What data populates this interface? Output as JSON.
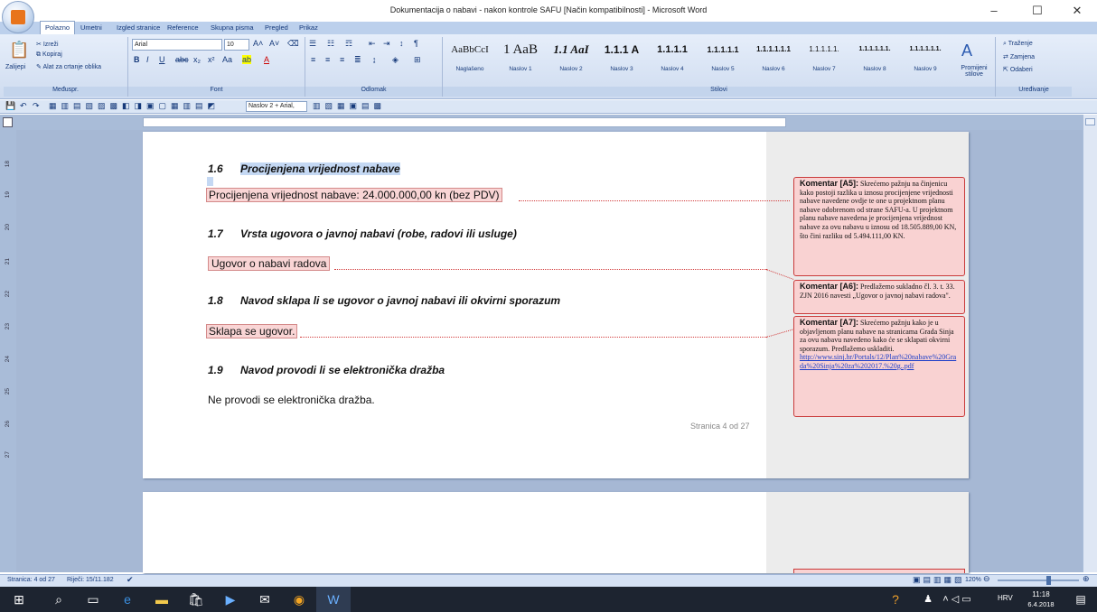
{
  "window": {
    "title": "Dokumentacija o nabavi - nakon kontrole SAFU [Način kompatibilnosti] - Microsoft Word",
    "minimize": "–",
    "maximize": "☐",
    "close": "✕"
  },
  "tabs": [
    "Polazno",
    "Umetni",
    "Izgled stranice",
    "Reference",
    "Skupna pisma",
    "Pregled",
    "Prikaz"
  ],
  "ribbon": {
    "clipboard": {
      "paste": "Zalijepi",
      "cut": "Izreži",
      "copy": "Kopiraj",
      "format_painter": "Alat za crtanje oblika",
      "label": "Međuspr."
    },
    "font": {
      "name": "Arial",
      "size": "10",
      "label": "Font"
    },
    "paragraph": {
      "label": "Odlomak"
    },
    "styles": {
      "label": "Stilovi",
      "items": [
        {
          "sample": "AaBbCcI",
          "name": "Naglašeno"
        },
        {
          "sample": "1 AaB",
          "name": "Naslov 1"
        },
        {
          "sample": "1.1 AaI",
          "name": "Naslov 2"
        },
        {
          "sample": "1.1.1 A",
          "name": "Naslov 3"
        },
        {
          "sample": "1.1.1.1",
          "name": "Naslov 4"
        },
        {
          "sample": "1.1.1.1.1",
          "name": "Naslov 5"
        },
        {
          "sample": "1.1.1.1.1.1",
          "name": "Naslov 6"
        },
        {
          "sample": "1.1.1.1.1.",
          "name": "Naslov 7"
        },
        {
          "sample": "1.1.1.1.1.1.",
          "name": "Naslov 8"
        },
        {
          "sample": "1.1.1.1.1.1.",
          "name": "Naslov 9"
        }
      ],
      "change_styles": "Promijeni stilove"
    },
    "editing": {
      "find": "Traženje",
      "replace": "Zamjena",
      "select": "Odaberi",
      "label": "Uređivanje"
    }
  },
  "qat": {
    "style_box": "Naslov 2 + Arial,"
  },
  "document": {
    "sections": [
      {
        "num": "1.6",
        "heading": "Procijenjena vrijednost nabave",
        "body": "Procijenjena vrijednost nabave: 24.000.000,00 kn (bez PDV)"
      },
      {
        "num": "1.7",
        "heading": "Vrsta ugovora o javnoj nabavi (robe, radovi ili usluge)",
        "body": "Ugovor o nabavi radova"
      },
      {
        "num": "1.8",
        "heading": "Navod sklapa li se ugovor o javnoj nabavi ili okvirni sporazum",
        "body": "Sklapa se ugovor."
      },
      {
        "num": "1.9",
        "heading": "Navod provodi li se elektronička dražba",
        "body": "Ne provodi se elektronička dražba."
      }
    ],
    "page_footer": "Stranica 4 od 27",
    "ruler_left": [
      "18",
      "19",
      "20",
      "21",
      "22",
      "23",
      "24",
      "25",
      "26",
      "27"
    ]
  },
  "comments": [
    {
      "label": "Komentar [A5]:",
      "text": "Skrećemo pažnju na činjenicu kako postoji razlika u iznosu procijenjene vrijednosti nabave navedene ovdje te one u projektnom planu nabave odobrenom od strane SAFU-a. U projektnom planu nabave navedena je procijenjena vrijednost nabave za ovu nabavu u iznosu od 18.505.889,00 KN, što čini razliku od 5.494.111,00 KN."
    },
    {
      "label": "Komentar [A6]:",
      "text": "Predlažemo sukladno čl. 3. t. 33. ZJN 2016 navesti „Ugovor o javnoj nabavi radova\"."
    },
    {
      "label": "Komentar [A7]:",
      "text": "Skrećemo pažnju kako je u objavljenom planu nabave na stranicama Grada Sinja za ovu nabavu navedeno kako će se sklapati okvirni sporazum. Predlažemo uskladiti.",
      "link": "http://www.sinj.hr/Portals/12/Plan%20nabave%20Grada%20Sinja%20za%202017.%20g..pdf"
    }
  ],
  "status": {
    "page": "Stranica: 4 od 27",
    "words": "Riječi: 15/11.182",
    "zoom": "120%"
  },
  "taskbar": {
    "lang": "HRV",
    "time": "11:18",
    "date": "6.4.2018"
  }
}
